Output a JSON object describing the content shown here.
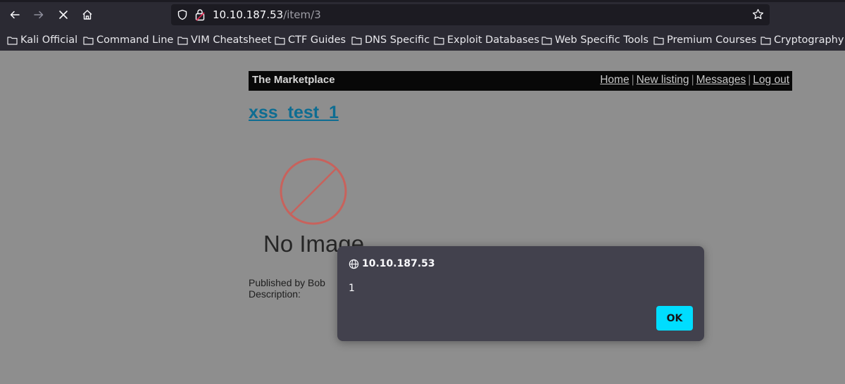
{
  "browser": {
    "url_host": "10.10.187.53",
    "url_path": "/item/3",
    "bookmarks": [
      {
        "label": "Kali Official"
      },
      {
        "label": "Command Line"
      },
      {
        "label": "VIM Cheatsheet"
      },
      {
        "label": "CTF Guides"
      },
      {
        "label": "DNS Specific"
      },
      {
        "label": "Exploit Databases"
      },
      {
        "label": "Web Specific Tools"
      },
      {
        "label": "Premium Courses"
      },
      {
        "label": "Cryptography"
      }
    ],
    "icons": [
      "back-icon",
      "forward-icon",
      "stop-icon",
      "home-icon",
      "shield-icon",
      "lock-icon",
      "star-icon",
      "folder-icon"
    ]
  },
  "site": {
    "brand": "The Marketplace",
    "nav": [
      {
        "label": "Home"
      },
      {
        "label": "New listing"
      },
      {
        "label": "Messages"
      },
      {
        "label": "Log out"
      }
    ],
    "separator": "|"
  },
  "item": {
    "title": "xss_test_1",
    "image_text": "No Image",
    "published_by": "Published by Bob",
    "description_label": "Description:"
  },
  "dialog": {
    "origin": "10.10.187.53",
    "message": "1",
    "ok_label": "OK"
  },
  "colors": {
    "accent_button": "#00ddff",
    "link_title": "#0e6d92",
    "dialog_bg": "#42414d",
    "chrome_bg": "#2b2a33"
  }
}
